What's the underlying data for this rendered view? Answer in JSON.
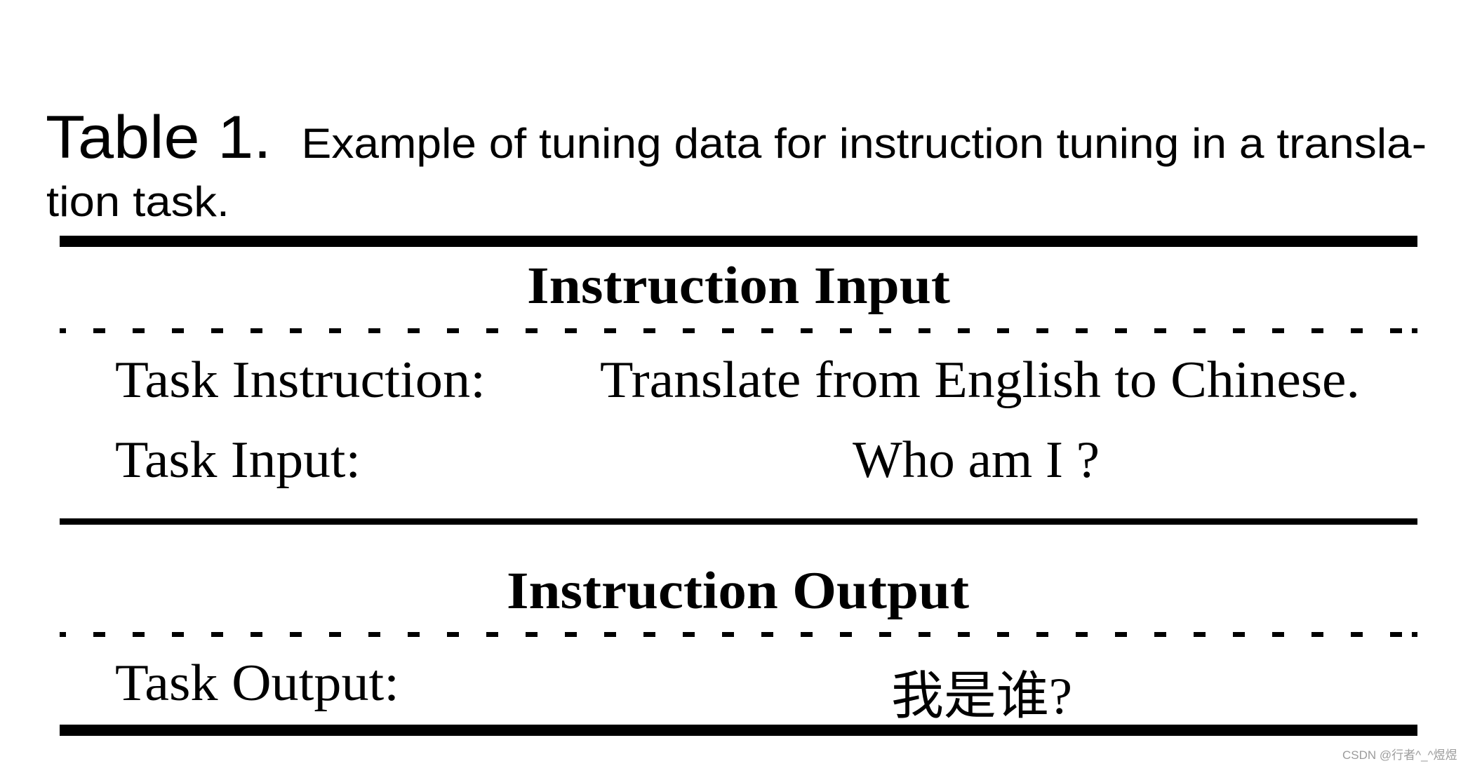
{
  "caption": {
    "label": "Table 1.",
    "text_line_1": "Example of tuning data for instruction tuning in a transla-",
    "text_line_2": "tion task."
  },
  "table": {
    "sections": [
      {
        "header": "Instruction Input",
        "rows": [
          {
            "label": "Task Instruction:",
            "value": "Translate from English to Chinese."
          },
          {
            "label": "Task Input:",
            "value": "Who am I ?"
          }
        ]
      },
      {
        "header": "Instruction Output",
        "rows": [
          {
            "label": "Task Output:",
            "value": "我是谁?"
          }
        ]
      }
    ]
  },
  "watermark": "CSDN @行者^_^煜煜"
}
